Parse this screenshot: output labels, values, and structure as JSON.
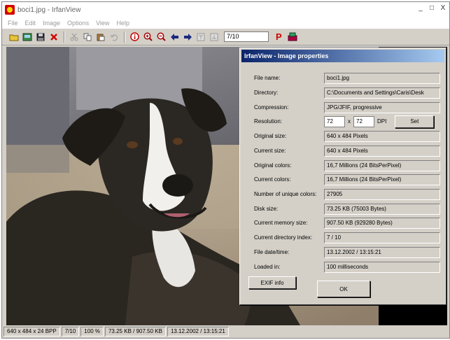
{
  "window": {
    "title": "boci1.jpg - IrfanView",
    "controls": [
      "_",
      "□",
      "X"
    ]
  },
  "menu": [
    "File",
    "Edit",
    "Image",
    "Options",
    "View",
    "Help"
  ],
  "toolbar": {
    "page_field": "7/10",
    "icons": [
      "open-folder-icon",
      "thumbnails-icon",
      "save-icon",
      "delete-icon",
      "cut-icon",
      "copy-icon",
      "paste-icon",
      "undo-icon",
      "info-icon",
      "zoom-in-icon",
      "zoom-out-icon",
      "previous-icon",
      "next-icon",
      "first-icon",
      "last-icon",
      "properties-icon",
      "slideshow-icon"
    ]
  },
  "statusbar": {
    "dimensions": "640 x 484 x 24 BPP",
    "position": "7/10",
    "zoom": "100 %",
    "sizes": "73.25 KB / 907.50 KB",
    "datetime": "13.12.2002 / 13:15:21"
  },
  "dialog": {
    "title": "IrfanView - Image properties",
    "rows": [
      {
        "label": "File name:",
        "value": "boci1.jpg"
      },
      {
        "label": "Directory:",
        "value": "C:\\Documents and Settings\\Caris\\Desk"
      },
      {
        "label": "Compression:",
        "value": "JPG/JFIF, progressive"
      },
      {
        "label": "Resolution:",
        "value": ""
      },
      {
        "label": "Original size:",
        "value": "640 x 484  Pixels"
      },
      {
        "label": "Current size:",
        "value": "640 x 484  Pixels"
      },
      {
        "label": "Original colors:",
        "value": "16,7 Millions  (24 BitsPerPixel)"
      },
      {
        "label": "Current colors:",
        "value": "16,7 Millions  (24 BitsPerPixel)"
      },
      {
        "label": "Number of unique colors:",
        "value": "27905"
      },
      {
        "label": "Disk size:",
        "value": "73.25 KB (75003 Bytes)"
      },
      {
        "label": "Current memory size:",
        "value": "907.50 KB (929280 Bytes)"
      },
      {
        "label": "Current directory index:",
        "value": "7  /  10"
      },
      {
        "label": "File date/time:",
        "value": "13.12.2002 / 13:15:21"
      },
      {
        "label": "Loaded in:",
        "value": "100 milliseconds"
      }
    ],
    "resolution": {
      "x": "72",
      "sep": "x",
      "y": "72",
      "unit": "DPI",
      "set_label": "Set"
    },
    "exif_label": "EXIF info",
    "ok_label": "OK"
  },
  "colors": {
    "dialog_title_start": "#0a246a",
    "dialog_title_end": "#a6caf0",
    "app_icon": "#d40000"
  }
}
